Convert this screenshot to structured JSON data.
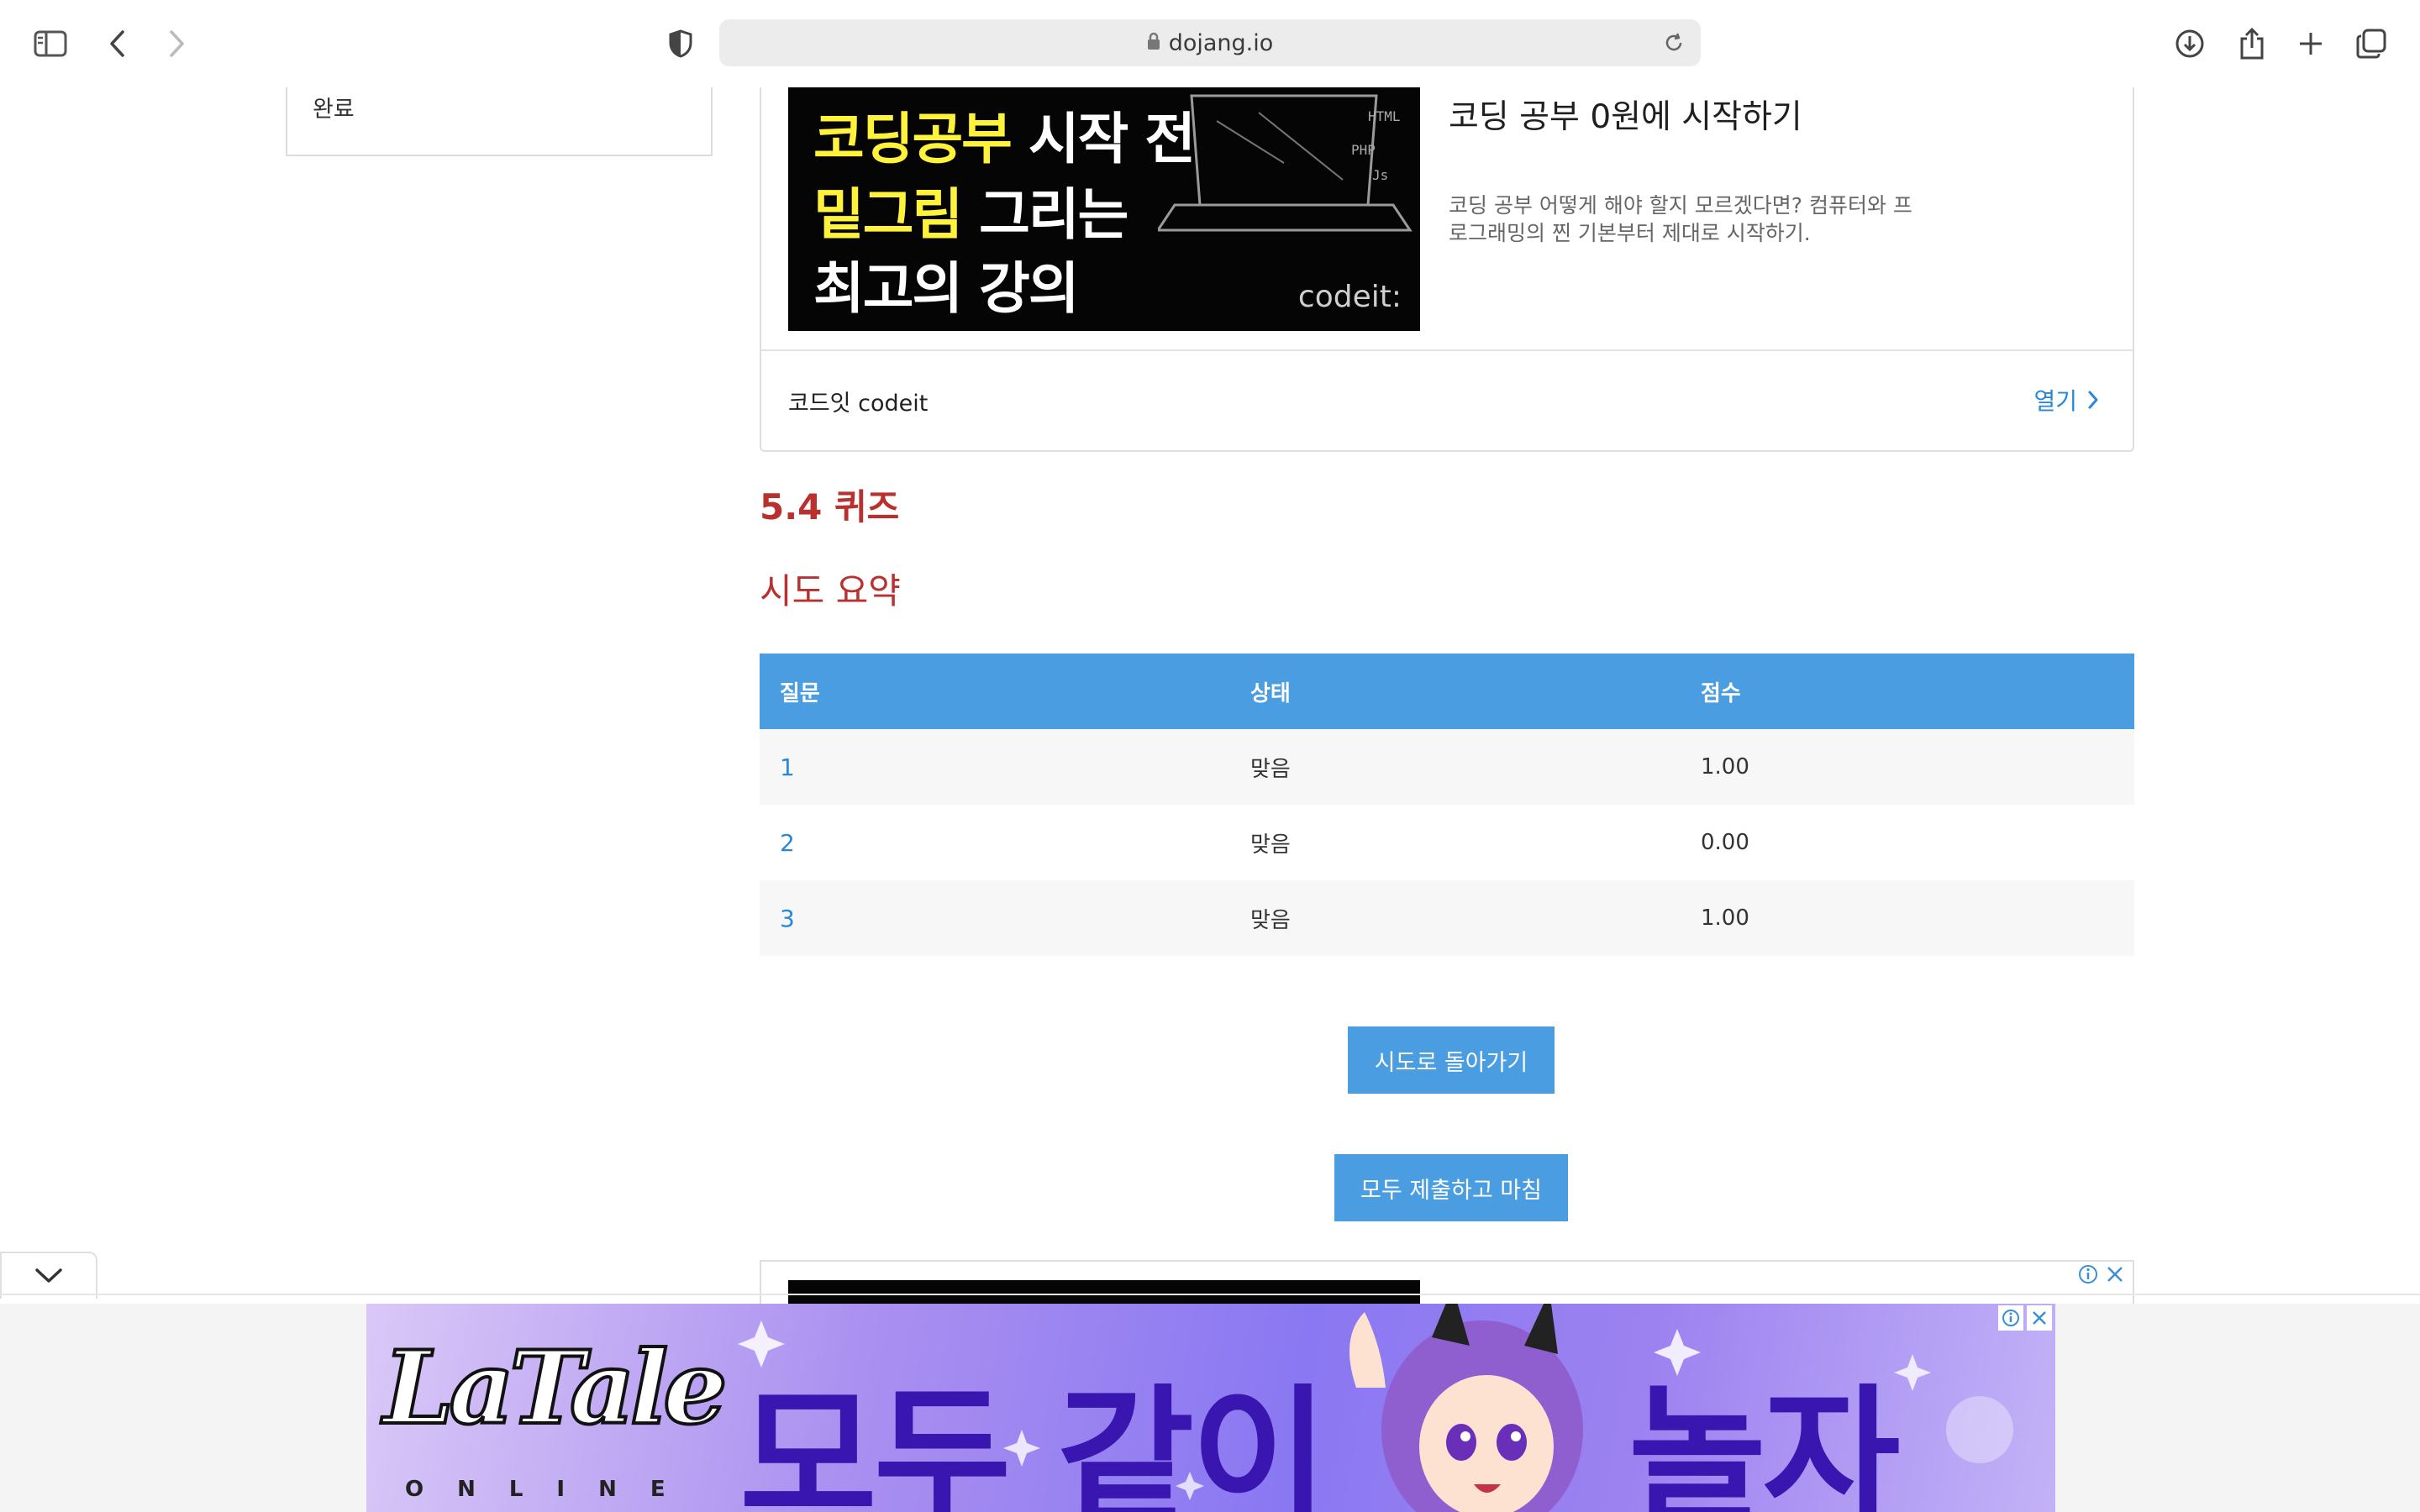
{
  "browser": {
    "url": "dojang.io"
  },
  "sidebar": {
    "item_label": "완료"
  },
  "ad_top": {
    "image_line1_yellow": "코딩공부",
    "image_line1_white": " 시작 전",
    "image_line2_yellow": "밑그림",
    "image_line2_white": " 그리는",
    "image_line3": "최고의 강의",
    "image_brand": "codeit:",
    "title": "코딩 공부 0원에 시작하기",
    "description": "코딩 공부 어떻게 해야 할지 모르겠다면? 컴퓨터와 프로그래밍의 찐 기본부터 제대로 시작하기.",
    "advertiser": "코드잇 codeit",
    "open_label": "열기"
  },
  "page": {
    "section_title": "5.4 퀴즈",
    "summary_title": "시도 요약"
  },
  "table": {
    "headers": [
      "질문",
      "상태",
      "점수"
    ],
    "rows": [
      {
        "question": "1",
        "status": "맞음",
        "score": "1.00"
      },
      {
        "question": "2",
        "status": "맞음",
        "score": "0.00"
      },
      {
        "question": "3",
        "status": "맞음",
        "score": "1.00"
      }
    ]
  },
  "buttons": {
    "back_to_attempt": "시도로 돌아가기",
    "submit_all": "모두 제출하고 마침"
  },
  "banner": {
    "logo": "LaTale",
    "logo_sub": "ONLINE",
    "text_left": "모두 같이",
    "text_right": "놀자"
  },
  "colors": {
    "accent": "#4a9de0",
    "heading": "#b8312f",
    "link": "#2b87d8"
  }
}
